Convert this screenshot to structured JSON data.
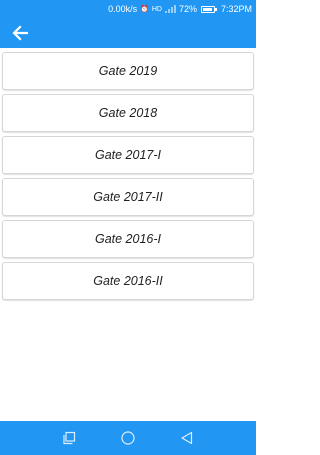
{
  "status_bar": {
    "speed": "0.00k/s",
    "battery_percent": "72%",
    "time": "7:32PM",
    "icons": [
      "alarm-icon",
      "hd-icon",
      "signal-icon",
      "battery-icon"
    ]
  },
  "app_bar": {
    "back_icon": "arrow-left-icon"
  },
  "items": [
    {
      "label": "Gate 2019"
    },
    {
      "label": "Gate 2018"
    },
    {
      "label": "Gate 2017-I"
    },
    {
      "label": "Gate 2017-II"
    },
    {
      "label": "Gate 2016-I"
    },
    {
      "label": "Gate 2016-II"
    }
  ],
  "nav_bar": {
    "icons": [
      "recent-apps-icon",
      "home-icon",
      "back-triangle-icon"
    ]
  },
  "colors": {
    "primary": "#2196f3",
    "item_border": "#d6d6d6",
    "text": "#222222"
  }
}
